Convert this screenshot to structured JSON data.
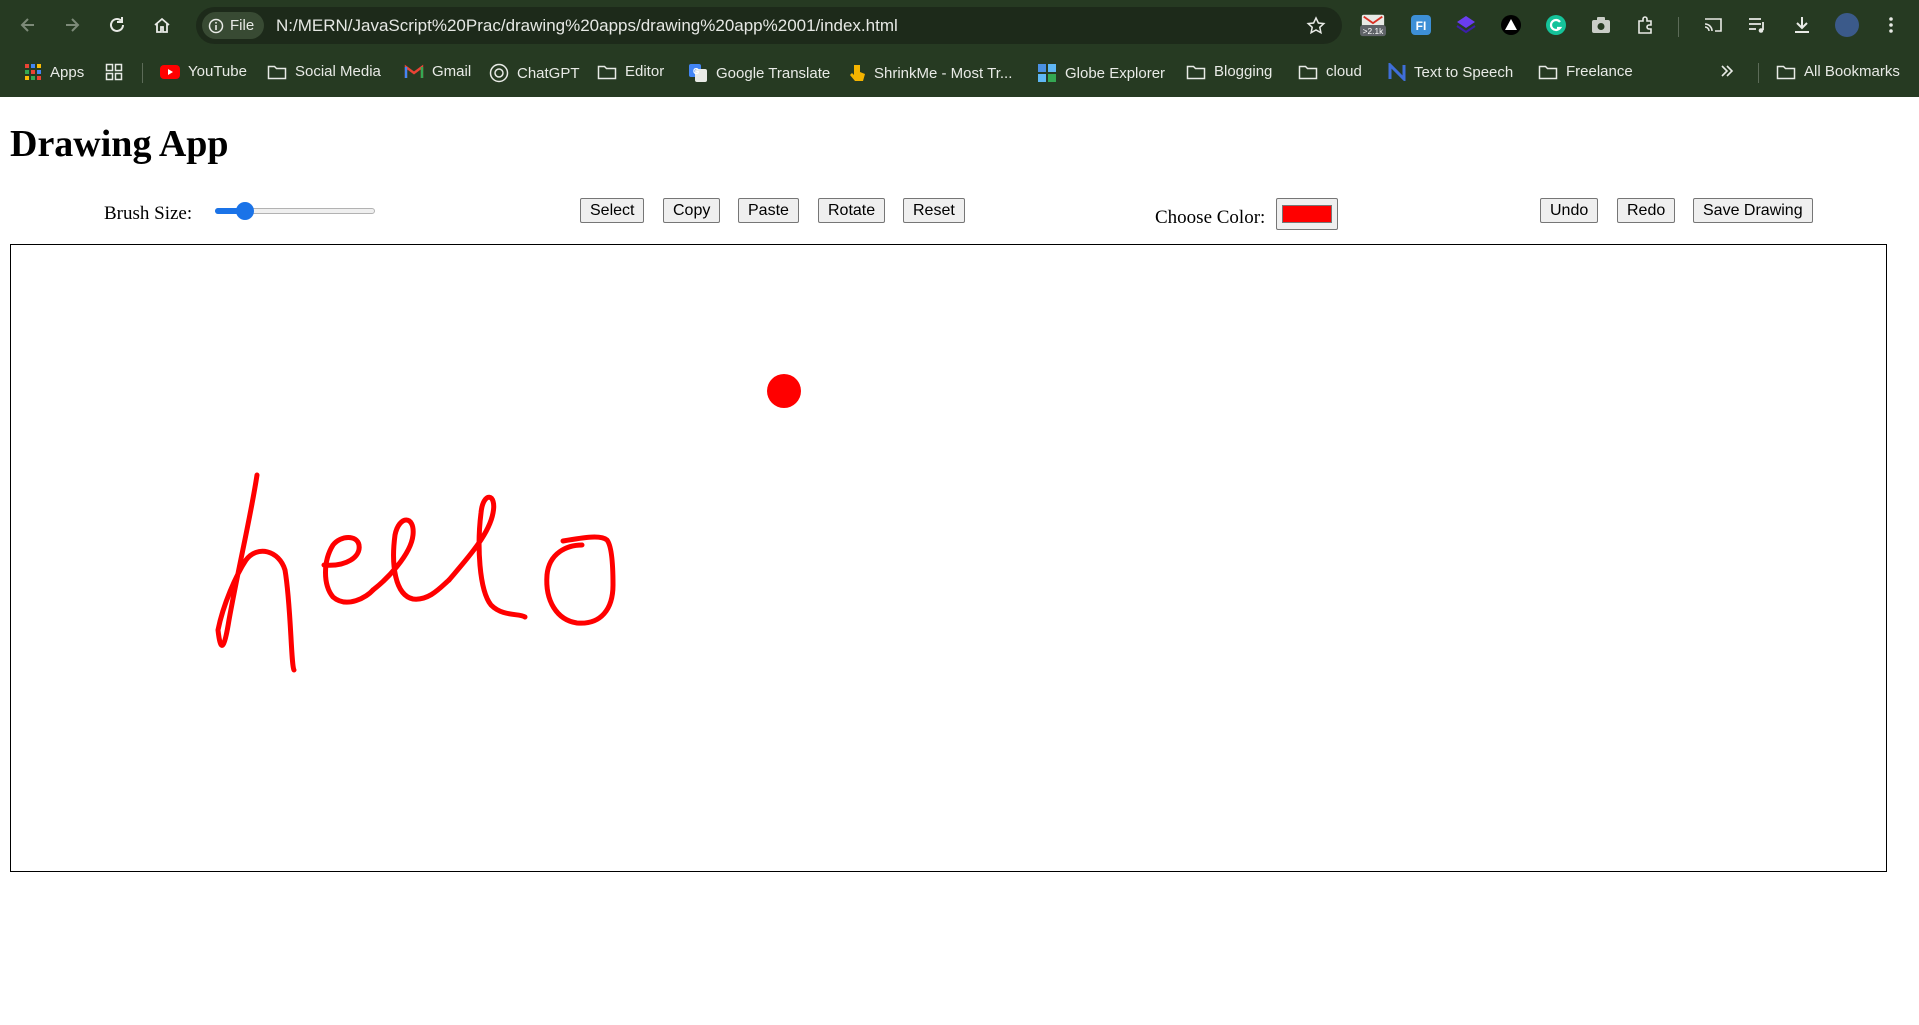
{
  "browser": {
    "file_chip": "File",
    "url": "N:/MERN/JavaScript%20Prac/drawing%20apps/drawing%20app%2001/index.html",
    "badge": ">2.1k",
    "ext_fi": "FI"
  },
  "bookmarks": {
    "apps": "Apps",
    "youtube": "YouTube",
    "social_media": "Social Media",
    "gmail": "Gmail",
    "chatgpt": "ChatGPT",
    "editor": "Editor",
    "google_translate": "Google Translate",
    "shrinkme": "ShrinkMe - Most Tr...",
    "globe_explorer": "Globe Explorer",
    "blogging": "Blogging",
    "cloud": "cloud",
    "text_to_speech": "Text to Speech",
    "freelance": "Freelance",
    "all_bookmarks": "All Bookmarks"
  },
  "page": {
    "title": "Drawing App",
    "brush_label": "Brush Size:",
    "brush_value": 0.15,
    "color_label": "Choose Color:",
    "color_value": "#ff0000",
    "buttons": {
      "select": "Select",
      "copy": "Copy",
      "paste": "Paste",
      "rotate": "Rotate",
      "reset": "Reset",
      "undo": "Undo",
      "redo": "Redo",
      "save": "Save Drawing"
    }
  },
  "colors": {
    "chrome": "#263a22",
    "accent": "#1a73e8",
    "ink": "#ff0000"
  }
}
